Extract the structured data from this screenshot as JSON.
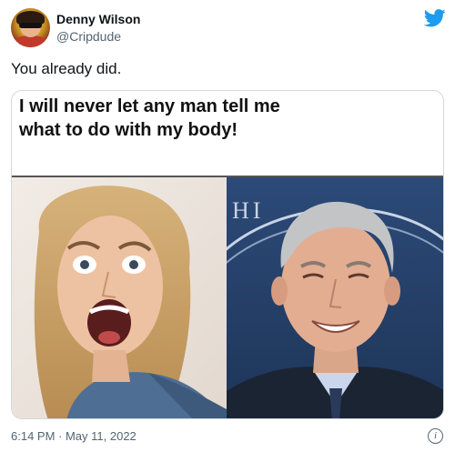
{
  "author": {
    "name": "Denny Wilson",
    "handle": "@Cripdude"
  },
  "tweet": {
    "text": "You already did."
  },
  "media": {
    "caption": "I will never let any man tell me what to do with my body!",
    "right_bg_text": "HI"
  },
  "footer": {
    "timestamp": "6:14 PM · May 11, 2022",
    "info_glyph": "i"
  },
  "colors": {
    "twitter_blue": "#1d9bf0",
    "secondary_text": "#536471"
  }
}
